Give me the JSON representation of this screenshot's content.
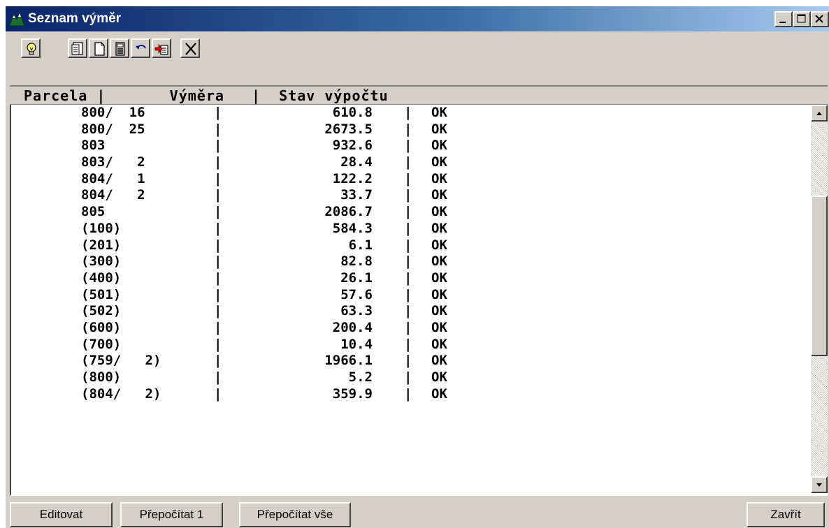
{
  "window": {
    "title": "Seznam výměr"
  },
  "toolbar": {
    "tools": [
      "lightbulb-icon",
      "document-list-icon",
      "new-page-icon",
      "calculator-icon",
      "undo-icon",
      "import-icon",
      "delete-x-icon"
    ]
  },
  "list": {
    "header": "Parcela |       Výměra   |  Stav výpočtu",
    "rows": [
      {
        "parcel": "800/  16 ",
        "area": "610.8",
        "status": "OK"
      },
      {
        "parcel": "800/  25 ",
        "area": "2673.5",
        "status": "OK"
      },
      {
        "parcel": "803      ",
        "area": "932.6",
        "status": "OK"
      },
      {
        "parcel": "803/   2 ",
        "area": "28.4",
        "status": "OK"
      },
      {
        "parcel": "804/   1 ",
        "area": "122.2",
        "status": "OK"
      },
      {
        "parcel": "804/   2 ",
        "area": "33.7",
        "status": "OK"
      },
      {
        "parcel": "805      ",
        "area": "2086.7",
        "status": "OK"
      },
      {
        "parcel": "(100)    ",
        "area": "584.3",
        "status": "OK"
      },
      {
        "parcel": "(201)    ",
        "area": "6.1",
        "status": "OK"
      },
      {
        "parcel": "(300)    ",
        "area": "82.8",
        "status": "OK"
      },
      {
        "parcel": "(400)    ",
        "area": "26.1",
        "status": "OK"
      },
      {
        "parcel": "(501)    ",
        "area": "57.6",
        "status": "OK"
      },
      {
        "parcel": "(502)    ",
        "area": "63.3",
        "status": "OK"
      },
      {
        "parcel": "(600)    ",
        "area": "200.4",
        "status": "OK"
      },
      {
        "parcel": "(700)    ",
        "area": "10.4",
        "status": "OK"
      },
      {
        "parcel": "(759/   2)",
        "area": "1966.1",
        "status": "OK"
      },
      {
        "parcel": "(800)    ",
        "area": "5.2",
        "status": "OK"
      },
      {
        "parcel": "(804/   2)",
        "area": "359.9",
        "status": "OK"
      }
    ]
  },
  "buttons": {
    "edit": "Editovat",
    "recalc_one": "Přepočítat 1",
    "recalc_all": "Přepočítat vše",
    "close": "Zavřít"
  },
  "colors": {
    "titlebar_start": "#0a246a",
    "titlebar_end": "#a6caf0",
    "face": "#d4d0c8"
  }
}
